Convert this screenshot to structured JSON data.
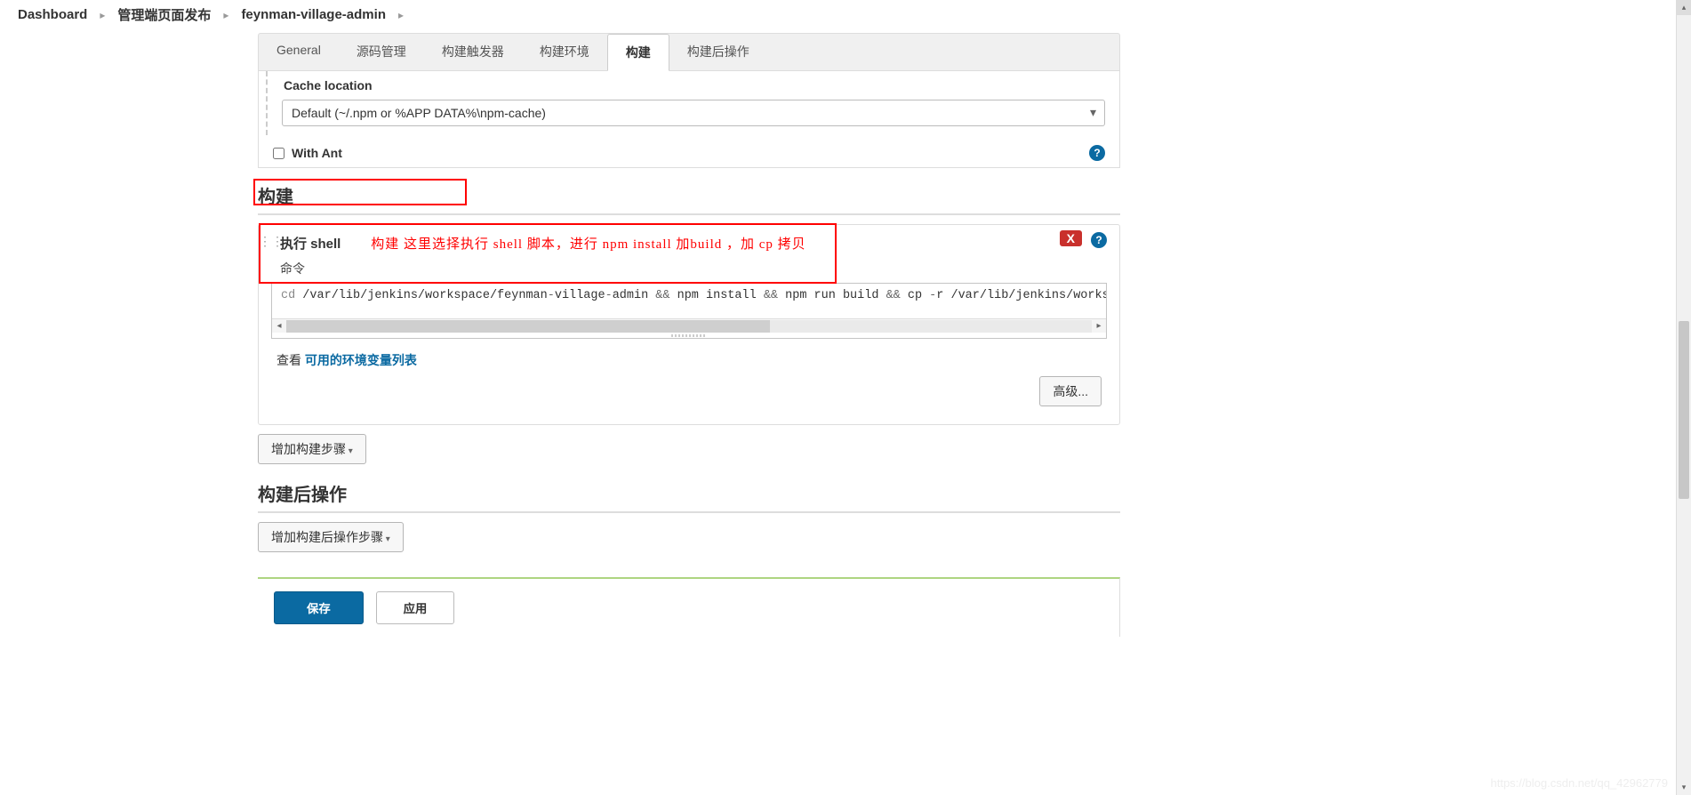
{
  "breadcrumb": {
    "items": [
      "Dashboard",
      "管理端页面发布",
      "feynman-village-admin"
    ]
  },
  "tabs": {
    "items": [
      "General",
      "源码管理",
      "构建触发器",
      "构建环境",
      "构建",
      "构建后操作"
    ],
    "active_index": 4
  },
  "cache": {
    "label": "Cache location",
    "selected": "Default (~/.npm or %APP DATA%\\npm-cache)"
  },
  "with_ant": {
    "label": "With Ant",
    "checked": false
  },
  "build_section": {
    "title": "构建",
    "annotation": "构建  这里选择执行  shell 脚本，进行 npm install 加build  ，加  cp  拷贝",
    "shell_title": "执行 shell",
    "command_label": "命令",
    "command": "cd /var/lib/jenkins/workspace/feynman-village-admin &&  npm install && npm run build && cp -r /var/lib/jenkins/workspace/f",
    "env_prefix": "查看 ",
    "env_link": "可用的环境变量列表",
    "advanced_btn": "高级...",
    "add_step_btn": "增加构建步骤",
    "x_badge": "X"
  },
  "post_section": {
    "title": "构建后操作",
    "add_post_btn": "增加构建后操作步骤"
  },
  "footer": {
    "save": "保存",
    "apply": "应用"
  },
  "watermark": "https://blog.csdn.net/qq_42962779"
}
